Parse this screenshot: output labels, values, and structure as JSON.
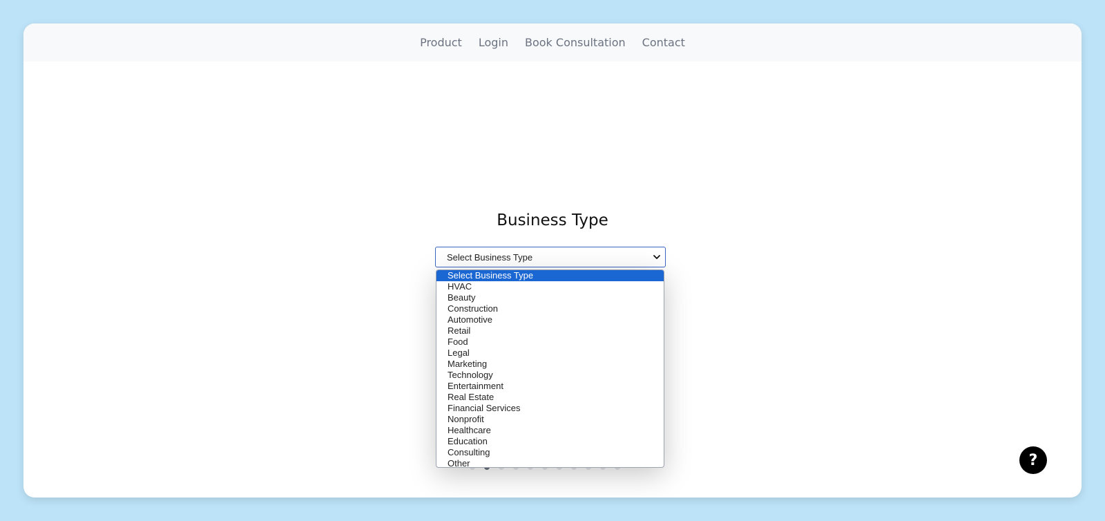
{
  "nav": {
    "items": [
      "Product",
      "Login",
      "Book Consultation",
      "Contact"
    ]
  },
  "form": {
    "title": "Business Type",
    "select_value": "Select Business Type",
    "options": [
      "Select Business Type",
      "HVAC",
      "Beauty",
      "Construction",
      "Automotive",
      "Retail",
      "Food",
      "Legal",
      "Marketing",
      "Technology",
      "Entertainment",
      "Real Estate",
      "Financial Services",
      "Nonprofit",
      "Healthcare",
      "Education",
      "Consulting",
      "Other"
    ],
    "selected_index": 0
  },
  "pagination": {
    "total_steps": 11,
    "current_step": 2
  },
  "help_button": {
    "label": "?"
  },
  "colors": {
    "page_background": "#bde3f8",
    "highlight": "#1a66d2",
    "select_border": "#3b64c7"
  },
  "icons": {
    "select_arrow": "chevron-down-icon"
  }
}
